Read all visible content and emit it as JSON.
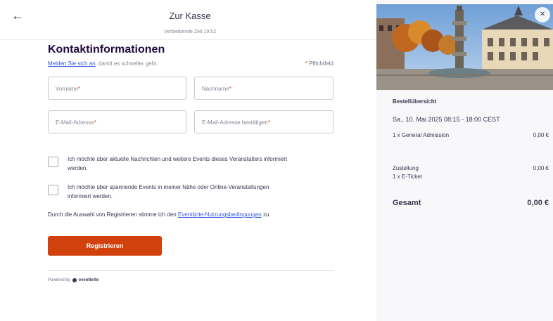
{
  "header": {
    "title": "Zur Kasse",
    "timer": "Verbleibende Zeit 19:52"
  },
  "form": {
    "heading": "Kontaktinformationen",
    "login_link": "Melden Sie sich an",
    "login_suffix": ", damit es schneller geht.",
    "required_star": "*",
    "required_note": " Pflichtfeld",
    "fields": {
      "first_name": "Vorname",
      "last_name": "Nachname",
      "email": "E-Mail-Adresse",
      "email_confirm": "E-Mail-Adresse bestätigen",
      "star": "*"
    },
    "checkboxes": [
      {
        "label": "Ich möchte über aktuelle Nachrichten und weitere Events dieses Veranstalters informiert werden.",
        "checked": false
      },
      {
        "label": "Ich möchte über spannende Events in meiner Nähe oder Online-Veranstaltungen informiert werden.",
        "checked": false
      }
    ],
    "terms_prefix": "Durch die Auswahl von Registrieren stimme ich den ",
    "terms_link": "Eventbrite-Nutzungsbedingungen",
    "terms_suffix": " zu.",
    "register_label": "Registrieren",
    "powered_by": "Powered by",
    "brand": "eventbrite"
  },
  "summary": {
    "title": "Bestellübersicht",
    "date": "Sa., 10. Mai 2025 08:15 - 18:00 CEST",
    "lines": [
      {
        "label": "1 x General Admission",
        "price": "0,00 €"
      },
      {
        "label": "Zustellung\n1 x E-Ticket",
        "price": "0,00 €"
      }
    ],
    "total_label": "Gesamt",
    "total_price": "0,00 €"
  },
  "icons": {
    "back": "arrow-left-icon",
    "close": "close-icon"
  },
  "colors": {
    "accent": "#d1410c",
    "link": "#3659e3",
    "text": "#39364f",
    "panel": "#f8f7fa"
  }
}
